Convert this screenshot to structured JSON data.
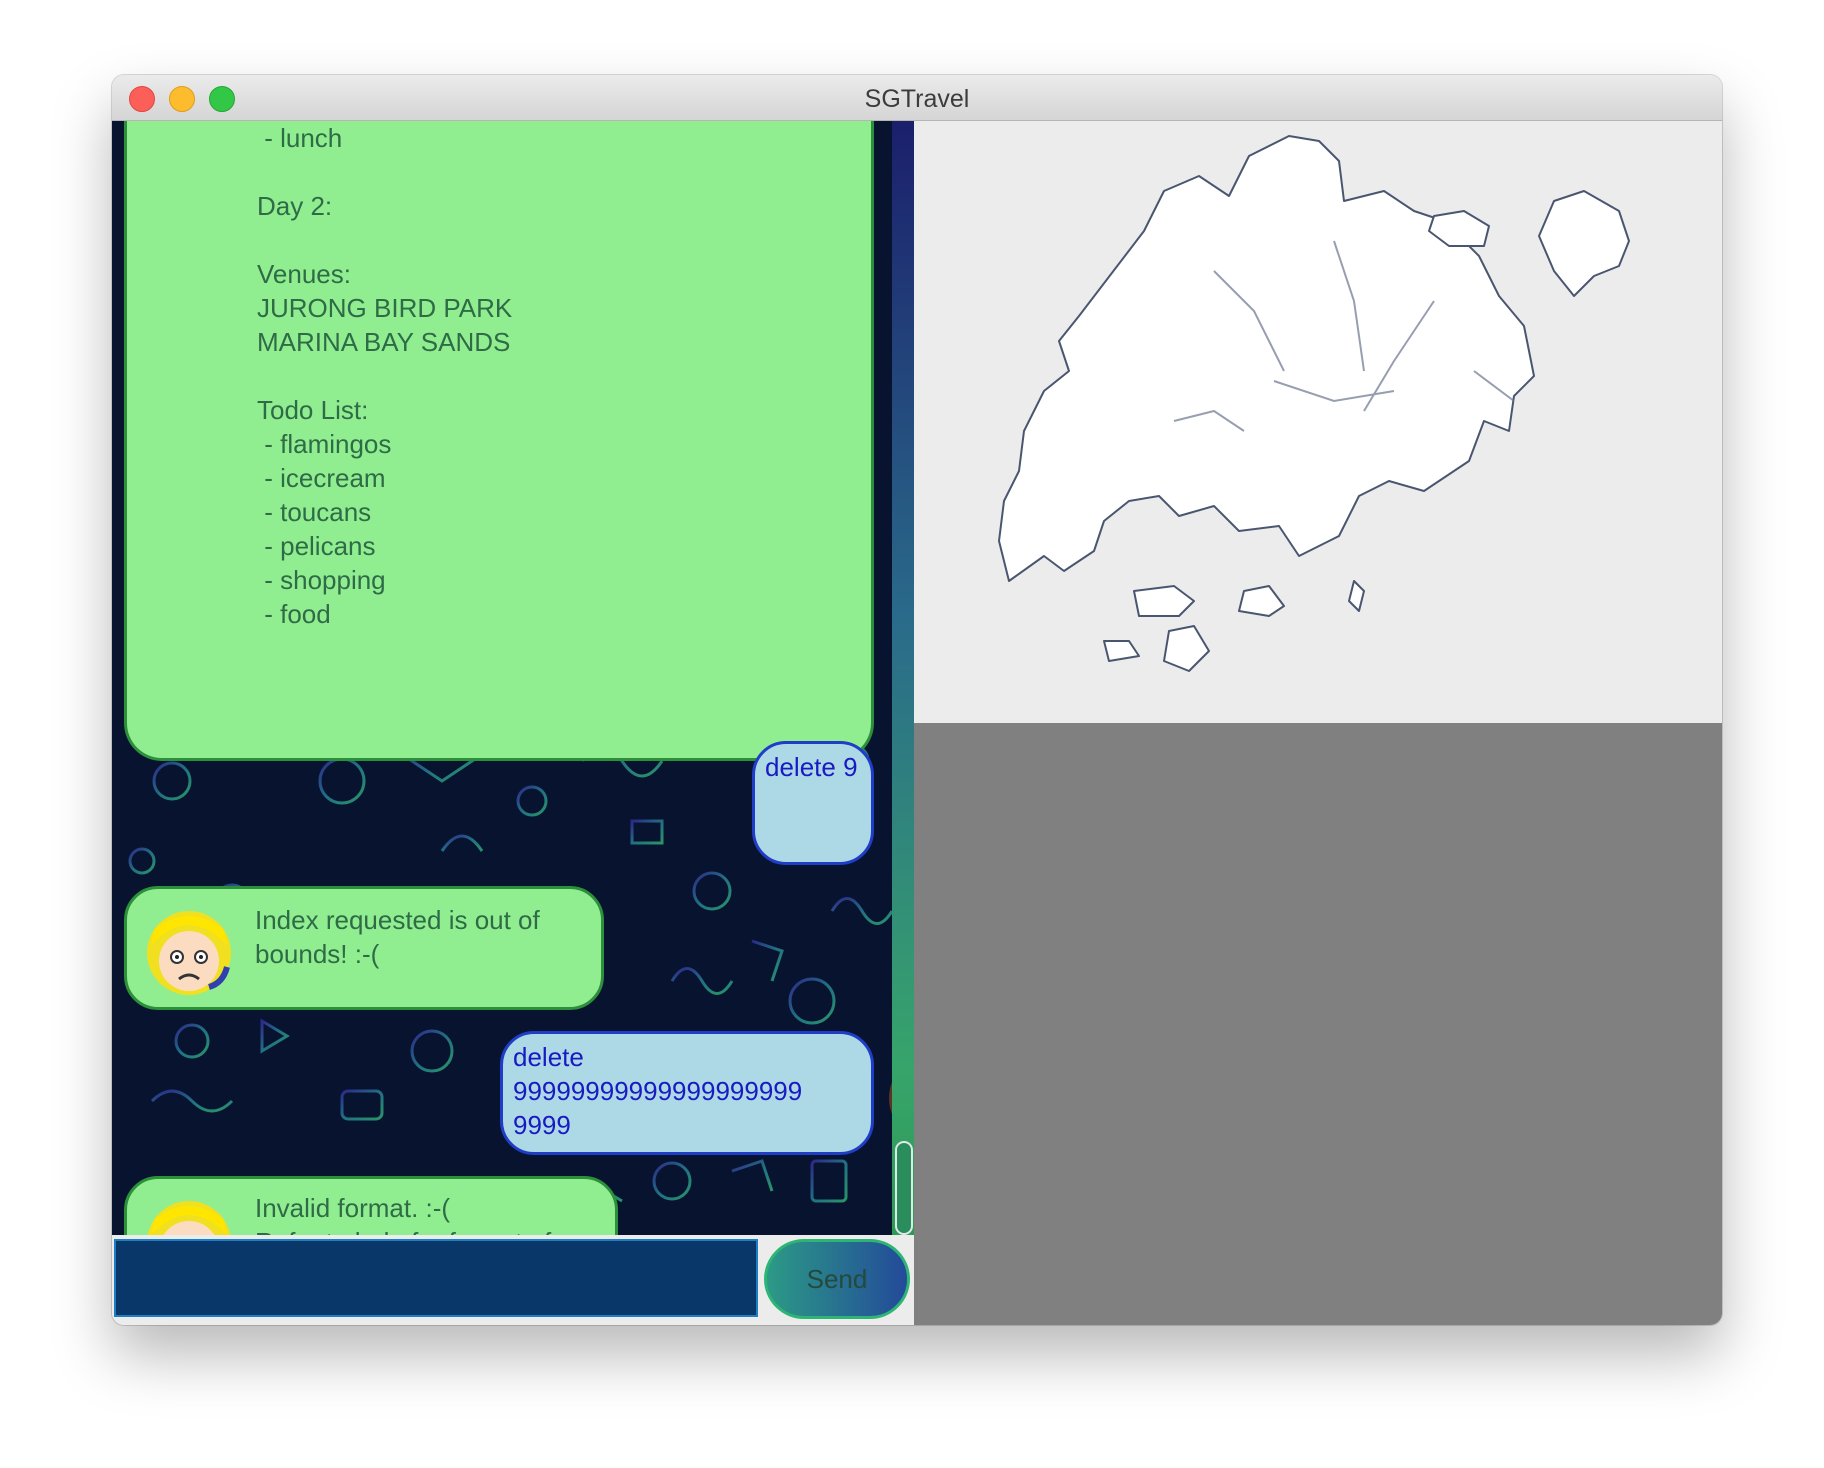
{
  "window": {
    "title": "SGTravel"
  },
  "chat": {
    "itinerary_text": " - lunch\n\nDay 2:\n\nVenues:\nJURONG BIRD PARK\nMARINA BAY SANDS\n\nTodo List:\n - flamingos\n - icecream\n - toucans\n - pelicans\n - shopping\n - food",
    "messages": [
      {
        "sender": "user",
        "text": "delete 9"
      },
      {
        "sender": "bot",
        "text": "Index requested is out of\nbounds! :-("
      },
      {
        "sender": "user",
        "text": "delete\n99999999999999999999\n9999"
      },
      {
        "sender": "bot",
        "text": "Invalid format. :-(\nRefer to help for format of\ninstructions."
      }
    ]
  },
  "input": {
    "value": "",
    "placeholder": ""
  },
  "send_button": {
    "label": "Send"
  },
  "map": {
    "region": "Singapore"
  },
  "colors": {
    "bot_bubble": "#90ee90",
    "user_bubble": "#add8e6",
    "input_bg": "#09376a",
    "right_lower_panel": "#808080"
  }
}
